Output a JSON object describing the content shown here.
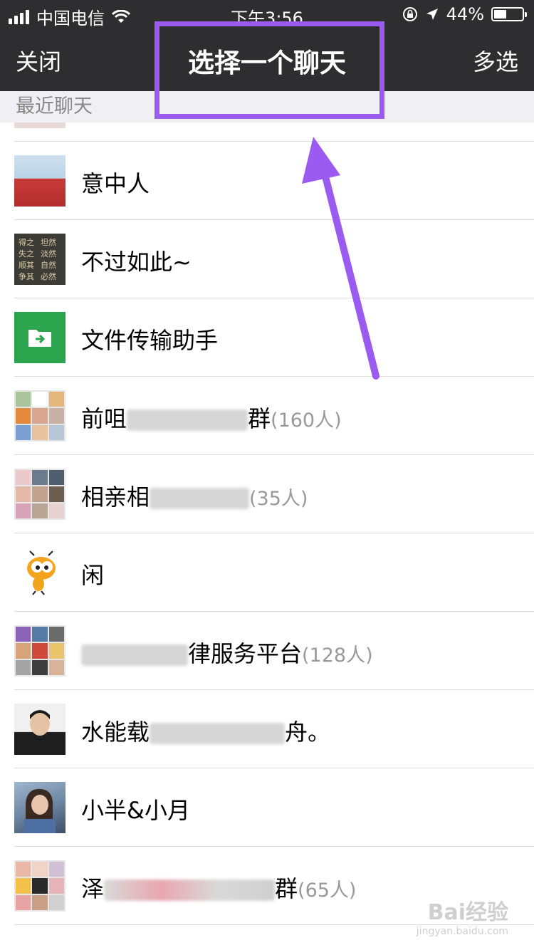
{
  "status_bar": {
    "carrier": "中国电信",
    "time": "下午3:56",
    "battery_percent": "44%",
    "battery_level": 0.44
  },
  "nav": {
    "close_label": "关闭",
    "title": "选择一个聊天",
    "multi_select_label": "多选"
  },
  "section": {
    "recent_chats": "最近聊天"
  },
  "chats": [
    {
      "name": "意中人",
      "count": ""
    },
    {
      "name": "不过如此~",
      "count": ""
    },
    {
      "name": "文件传输助手",
      "count": ""
    },
    {
      "name": "前咀",
      "name_suffix": "群",
      "count": "(160人)"
    },
    {
      "name": "相亲相",
      "name_suffix": "",
      "count": "(35人)"
    },
    {
      "name": "闲",
      "count": ""
    },
    {
      "name": "律服务平台",
      "name_suffix": "",
      "count": "(128人)"
    },
    {
      "name": "水能载",
      "name_suffix": "舟。",
      "count": ""
    },
    {
      "name": "小半&小月",
      "count": ""
    },
    {
      "name": "泽",
      "name_suffix": "群",
      "count": "(65人)"
    }
  ],
  "avatar_text": [
    "得之",
    "坦然",
    "失之",
    "淡然",
    "顺其",
    "自然",
    "争其",
    "必然"
  ],
  "colors": {
    "nav_bg": "#2e2e30",
    "highlight": "#9b5bf0",
    "file_helper": "#2ca44d"
  },
  "watermark": {
    "brand": "Bai经验",
    "url": "jingyan.baidu.com"
  }
}
